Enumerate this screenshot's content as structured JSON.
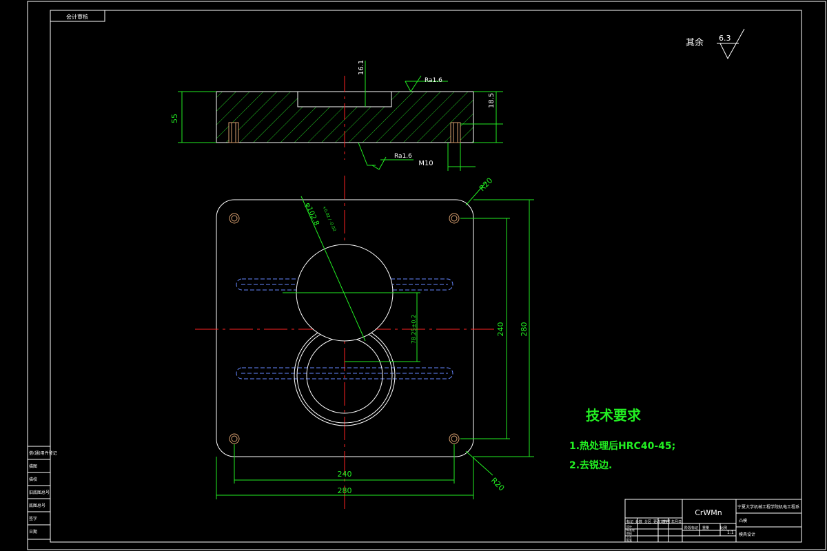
{
  "drawing": {
    "top_left_box": "会计审核",
    "surface_finish": {
      "label": "其余",
      "value": "6.3"
    },
    "material": "CrWMn",
    "title_block": {
      "school": "宁夏大学机械工程学院机电工程系",
      "drawing_name": "凸模",
      "drawing_no": "模具设计",
      "row_labels": [
        "标记",
        "处数",
        "分区",
        "更改文件号",
        "签名",
        "年月日"
      ],
      "mid_labels": [
        "阶段标记",
        "重量",
        "比例"
      ],
      "ratio": "1:1",
      "bottom_labels": [
        "设计",
        "标准化",
        "审核",
        "工艺",
        "批准"
      ]
    },
    "left_strip": [
      "借(通)用件登记",
      "描图",
      "描校",
      "旧底图总号",
      "底图总号",
      "签字",
      "日期"
    ]
  },
  "dimensions": {
    "top_view": {
      "height": "55",
      "slot_depth": "16.1",
      "right_depth": "18.5",
      "thread": "M10",
      "roughness_top": "Ra1.6",
      "roughness_bottom": "Ra1.6"
    },
    "plan_view": {
      "radius_top": "R20",
      "radius_bottom": "R20",
      "diameter": "φ102.8",
      "diameter_tol": "+0.02 / -0.02",
      "pitch": "78.25±0.2",
      "inner_height": "240",
      "outer_height": "280",
      "inner_width": "240",
      "outer_width": "280"
    }
  },
  "notes": {
    "title": "技术要求",
    "items": [
      "1.热处理后HRC40-45;",
      "2.去锐边."
    ]
  }
}
